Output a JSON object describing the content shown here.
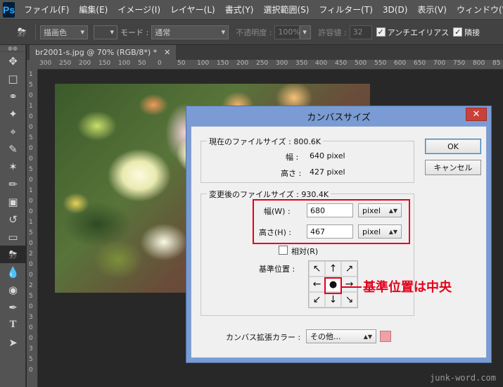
{
  "app": {
    "logo": "Ps",
    "menu": [
      "ファイル(F)",
      "編集(E)",
      "イメージ(I)",
      "レイヤー(L)",
      "書式(Y)",
      "選択範囲(S)",
      "フィルター(T)",
      "3D(D)",
      "表示(V)",
      "ウィンドウ(W"
    ]
  },
  "options": {
    "tool_icon": "paint-bucket-icon",
    "fill_source": "描画色",
    "mode_label": "モード :",
    "mode_value": "通常",
    "opacity_label": "不透明度 :",
    "opacity_value": "100%",
    "tolerance_label": "許容値 :",
    "tolerance_value": "32",
    "antialias_label": "アンチエイリアス",
    "contiguous_label": "隣接"
  },
  "document": {
    "tab_label": "br2001-s.jpg @ 70% (RGB/8*) *",
    "ruler_h": [
      "300",
      "250",
      "200",
      "150",
      "100",
      "50",
      "0",
      "50",
      "100",
      "150",
      "200",
      "250",
      "300",
      "350",
      "400",
      "450",
      "500",
      "550",
      "600",
      "650",
      "700",
      "750",
      "800",
      "85"
    ],
    "ruler_v": [
      "1",
      "5",
      "0",
      "1",
      "0",
      "0",
      "5",
      "0",
      "0",
      "5",
      "0",
      "1",
      "0",
      "0",
      "1",
      "5",
      "0",
      "2",
      "0",
      "0",
      "2",
      "5",
      "0",
      "3",
      "0",
      "0",
      "3",
      "5",
      "0"
    ]
  },
  "dialog": {
    "title": "カンバスサイズ",
    "close": "✕",
    "current": {
      "title": "現在のファイルサイズ : 800.6K",
      "width_label": "幅 :",
      "width_value": "640 pixel",
      "height_label": "高さ :",
      "height_value": "427 pixel"
    },
    "new": {
      "title": "変更後のファイルサイズ : 930.4K",
      "width_label": "幅(W) :",
      "width_value": "680",
      "width_unit": "pixel",
      "height_label": "高さ(H) :",
      "height_value": "467",
      "height_unit": "pixel",
      "relative_label": "相対(R)",
      "anchor_label": "基準位置 :",
      "anchor_arrows": [
        "↖",
        "↑",
        "↗",
        "←",
        "●",
        "→",
        "↙",
        "↓",
        "↘"
      ]
    },
    "ok_label": "OK",
    "cancel_label": "キャンセル",
    "extension_color_label": "カンバス拡張カラー :",
    "extension_color_value": "その他...",
    "swatch_color": "#f0a0a7"
  },
  "annotation": {
    "text": "基準位置は中央",
    "color": "#e4001b"
  },
  "watermark": "junk-word.com"
}
